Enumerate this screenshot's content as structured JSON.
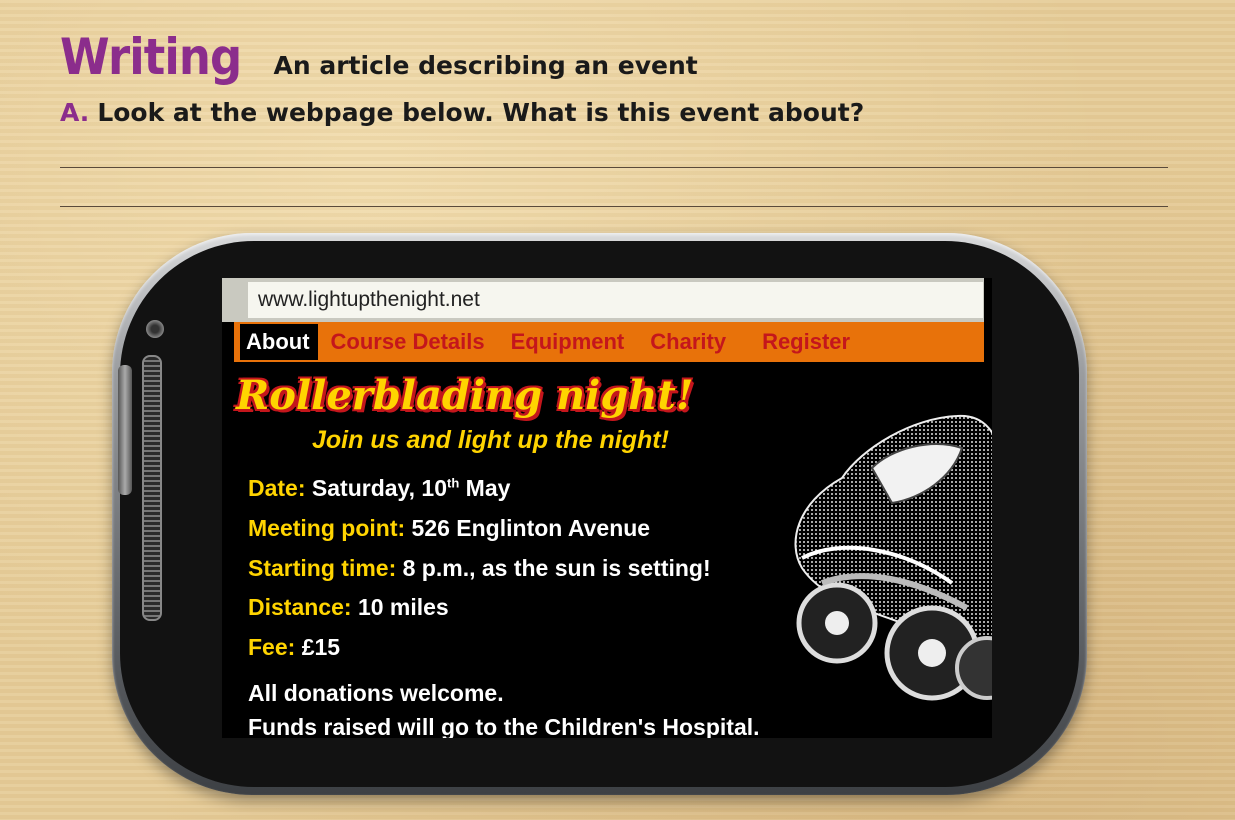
{
  "worksheet": {
    "section_title": "Writing",
    "section_subtitle": "An article describing an event",
    "question_letter": "A.",
    "question_text": "Look at the webpage below. What is this event about?"
  },
  "webpage": {
    "url": "www.lightupthenight.net",
    "nav": [
      {
        "label": "About",
        "active": true
      },
      {
        "label": "Course Details",
        "active": false
      },
      {
        "label": "Equipment",
        "active": false
      },
      {
        "label": "Charity",
        "active": false
      },
      {
        "label": "Register",
        "active": false
      }
    ],
    "title": "Rollerblading night!",
    "tagline": "Join us and light up the night!",
    "details": {
      "date_label": "Date:",
      "date_value": "Saturday, 10",
      "date_suffix": "th",
      "date_month": " May",
      "meeting_label": "Meeting point:",
      "meeting_value": "526 Englinton Avenue",
      "start_label": "Starting time:",
      "start_value": "8 p.m., as the sun is setting!",
      "distance_label": "Distance:",
      "distance_value": "10 miles",
      "fee_label": "Fee:",
      "fee_value": "£15"
    },
    "note_line1": "All donations welcome.",
    "note_line2": "Funds raised will go to the Children's Hospital."
  },
  "icons": {
    "image": "rollerblade-skate-icon"
  },
  "colors": {
    "accent_purple": "#8b2d8c",
    "nav_orange": "#e8720a",
    "nav_text_red": "#c4161c",
    "highlight_yellow": "#ffd400"
  }
}
